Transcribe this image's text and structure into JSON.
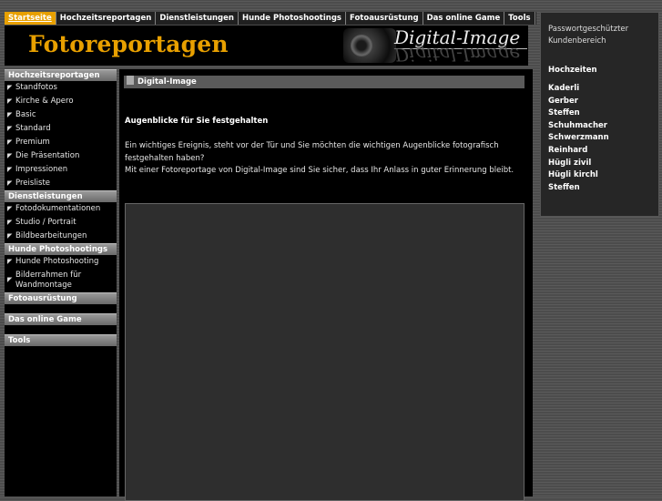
{
  "topnav": {
    "tabs": [
      {
        "label": "Startseite",
        "active": true
      },
      {
        "label": "Hochzeitsreportagen",
        "active": false
      },
      {
        "label": "Dienstleistungen",
        "active": false
      },
      {
        "label": "Hunde Photoshootings",
        "active": false
      },
      {
        "label": "Fotoausrüstung",
        "active": false
      },
      {
        "label": "Das online Game",
        "active": false
      },
      {
        "label": "Tools",
        "active": false
      }
    ]
  },
  "header": {
    "title": "Fotoreportagen",
    "logo_text": "Digital-Image"
  },
  "sidebar": {
    "sections": [
      {
        "title": "Hochzeitsreportagen",
        "items": [
          "Standfotos",
          "Kirche & Apero",
          "Basic",
          "Standard",
          "Premium",
          "Die Präsentation",
          "Impressionen",
          "Preisliste"
        ]
      },
      {
        "title": "Dienstleistungen",
        "items": [
          "Fotodokumentationen",
          "Studio / Portrait",
          "Bildbearbeitungen"
        ]
      },
      {
        "title": "Hunde Photoshootings",
        "items": [
          "Hunde Photoshooting",
          "Bilderrahmen für Wandmontage"
        ]
      },
      {
        "title": "Fotoausrüstung",
        "items": []
      },
      {
        "title": "Das online Game",
        "items": []
      },
      {
        "title": "Tools",
        "items": []
      }
    ]
  },
  "content": {
    "box_title": "Digital-Image",
    "headline": "Augenblicke für Sie festgehalten",
    "paragraph1": "Ein wichtiges Ereignis, steht vor der Tür und Sie möchten die wichtigen Augenblicke fotografisch festgehalten haben?",
    "paragraph2": "Mit einer Fotoreportage von Digital-Image sind Sie sicher, dass Ihr Anlass in guter Erinnerung bleibt."
  },
  "rightbox": {
    "login_link": "Passwortgeschützter Kundenbereich",
    "section_title": "Hochzeiten",
    "weddings": [
      "Kaderli",
      "Gerber",
      "Steffen",
      "Schuhmacher",
      "Schwerzmann",
      "Reinhard",
      "Hügli zivil",
      "Hügli kirchl",
      "Steffen"
    ]
  },
  "colors": {
    "accent": "#e8a000",
    "panel": "#000000",
    "category_bar": "#808080"
  }
}
